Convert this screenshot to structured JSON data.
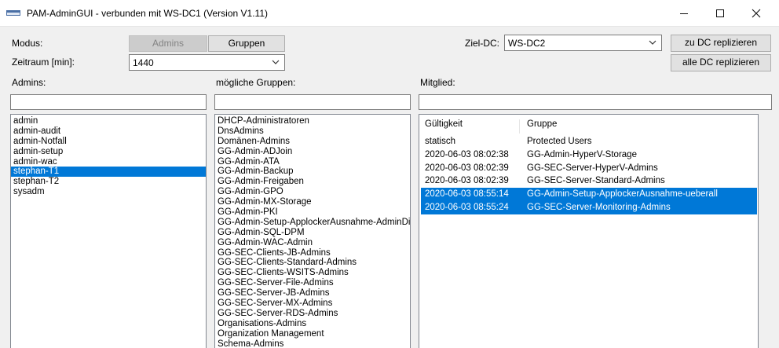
{
  "window": {
    "title": "PAM-AdminGUI - verbunden mit WS-DC1 (Version V1.11)"
  },
  "controls": {
    "modus_label": "Modus:",
    "admins_button": "Admins",
    "gruppen_button": "Gruppen",
    "zeitraum_label": "Zeitraum [min]:",
    "zeitraum_value": "1440",
    "ziel_dc_label": "Ziel-DC:",
    "ziel_dc_value": "WS-DC2",
    "replicate_dc_button": "zu DC replizieren",
    "replicate_all_button": "alle DC replizieren"
  },
  "admins": {
    "label": "Admins:",
    "filter_value": "",
    "items": [
      "admin",
      "admin-audit",
      "admin-Notfall",
      "admin-setup",
      "admin-wac",
      "stephan-T1",
      "stephan-T2",
      "sysadm"
    ],
    "selected_index": 5
  },
  "groups": {
    "label": "mögliche Gruppen:",
    "filter_value": "",
    "items": [
      "DHCP-Administratoren",
      "DnsAdmins",
      "Domänen-Admins",
      "GG-Admin-ADJoin",
      "GG-Admin-ATA",
      "GG-Admin-Backup",
      "GG-Admin-Freigaben",
      "GG-Admin-GPO",
      "GG-Admin-MX-Storage",
      "GG-Admin-PKI",
      "GG-Admin-Setup-ApplockerAusnahme-AdminDir",
      "GG-Admin-SQL-DPM",
      "GG-Admin-WAC-Admin",
      "GG-SEC-Clients-JB-Admins",
      "GG-SEC-Clients-Standard-Admins",
      "GG-SEC-Clients-WSITS-Admins",
      "GG-SEC-Server-File-Admins",
      "GG-SEC-Server-JB-Admins",
      "GG-SEC-Server-MX-Admins",
      "GG-SEC-Server-RDS-Admins",
      "Organisations-Admins",
      "Organization Management",
      "Schema-Admins"
    ]
  },
  "member": {
    "label": "Mitglied:",
    "filter_value": "",
    "columns": [
      "Gültigkeit",
      "Gruppe"
    ],
    "rows": [
      {
        "validity": "statisch",
        "group": "Protected Users",
        "selected": false
      },
      {
        "validity": "2020-06-03 08:02:38",
        "group": "GG-Admin-HyperV-Storage",
        "selected": false
      },
      {
        "validity": "2020-06-03 08:02:39",
        "group": "GG-SEC-Server-HyperV-Admins",
        "selected": false
      },
      {
        "validity": "2020-06-03 08:02:39",
        "group": "GG-SEC-Server-Standard-Admins",
        "selected": false
      },
      {
        "validity": "2020-06-03 08:55:14",
        "group": "GG-Admin-Setup-ApplockerAusnahme-ueberall",
        "selected": true
      },
      {
        "validity": "2020-06-03 08:55:24",
        "group": "GG-SEC-Server-Monitoring-Admins",
        "selected": true
      }
    ]
  },
  "icons": {
    "app": "window-app-icon",
    "minimize": "minimize-icon",
    "maximize": "maximize-icon",
    "close": "close-icon",
    "dropdown": "chevron-down-icon"
  }
}
